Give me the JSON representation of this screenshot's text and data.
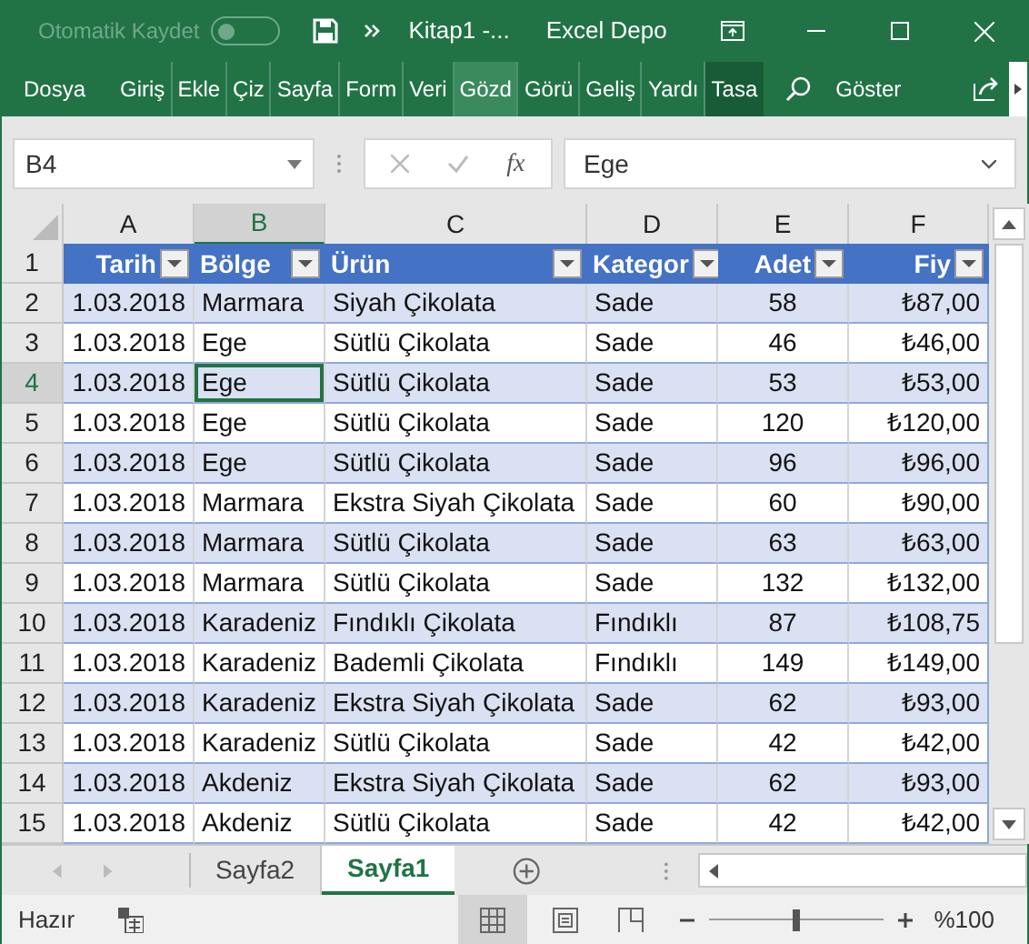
{
  "title_bar": {
    "autosave_label": "Otomatik Kaydet",
    "autosave_on": false,
    "document": "Kitap1  -...",
    "app": "Excel Depo"
  },
  "ribbon_tabs": [
    {
      "label": "Dosya",
      "kind": "file",
      "hovered": false
    },
    {
      "label": "Giriş",
      "kind": "standard",
      "hovered": false
    },
    {
      "label": "Ekle",
      "kind": "standard",
      "hovered": false
    },
    {
      "label": "Çiz",
      "kind": "standard",
      "hovered": false
    },
    {
      "label": "Sayfa",
      "kind": "standard",
      "hovered": false
    },
    {
      "label": "Form",
      "kind": "standard",
      "hovered": false
    },
    {
      "label": "Veri",
      "kind": "standard",
      "hovered": false
    },
    {
      "label": "Gözd",
      "kind": "standard",
      "hovered": true
    },
    {
      "label": "Görü",
      "kind": "standard",
      "hovered": false
    },
    {
      "label": "Geliş",
      "kind": "standard",
      "hovered": false
    },
    {
      "label": "Yardı",
      "kind": "standard",
      "hovered": false
    },
    {
      "label": "Tasa",
      "kind": "contextual",
      "hovered": false
    }
  ],
  "tell_me": "Göster",
  "name_box": "B4",
  "formula_bar": {
    "fx": "fx",
    "value": "Ege"
  },
  "columns": [
    {
      "label": "A",
      "selected": false
    },
    {
      "label": "B",
      "selected": true
    },
    {
      "label": "C",
      "selected": false
    },
    {
      "label": "D",
      "selected": false
    },
    {
      "label": "E",
      "selected": false
    },
    {
      "label": "F",
      "selected": false
    }
  ],
  "table_header": {
    "number": "1",
    "cells": [
      "Tarih",
      "Bölge",
      "Ürün",
      "Kategor",
      "Adet",
      "Fiy"
    ]
  },
  "rows": [
    {
      "number": "2",
      "selected": false,
      "cells": [
        "1.03.2018",
        "Marmara",
        "Siyah Çikolata",
        "Sade",
        "58",
        "₺87,00"
      ]
    },
    {
      "number": "3",
      "selected": false,
      "cells": [
        "1.03.2018",
        "Ege",
        "Sütlü Çikolata",
        "Sade",
        "46",
        "₺46,00"
      ]
    },
    {
      "number": "4",
      "selected": true,
      "cells": [
        "1.03.2018",
        "Ege",
        "Sütlü Çikolata",
        "Sade",
        "53",
        "₺53,00"
      ]
    },
    {
      "number": "5",
      "selected": false,
      "cells": [
        "1.03.2018",
        "Ege",
        "Sütlü Çikolata",
        "Sade",
        "120",
        "₺120,00"
      ]
    },
    {
      "number": "6",
      "selected": false,
      "cells": [
        "1.03.2018",
        "Ege",
        "Sütlü Çikolata",
        "Sade",
        "96",
        "₺96,00"
      ]
    },
    {
      "number": "7",
      "selected": false,
      "cells": [
        "1.03.2018",
        "Marmara",
        "Ekstra Siyah Çikolata",
        "Sade",
        "60",
        "₺90,00"
      ]
    },
    {
      "number": "8",
      "selected": false,
      "cells": [
        "1.03.2018",
        "Marmara",
        "Sütlü Çikolata",
        "Sade",
        "63",
        "₺63,00"
      ]
    },
    {
      "number": "9",
      "selected": false,
      "cells": [
        "1.03.2018",
        "Marmara",
        "Sütlü Çikolata",
        "Sade",
        "132",
        "₺132,00"
      ]
    },
    {
      "number": "10",
      "selected": false,
      "cells": [
        "1.03.2018",
        "Karadeniz",
        "Fındıklı Çikolata",
        "Fındıklı",
        "87",
        "₺108,75"
      ]
    },
    {
      "number": "11",
      "selected": false,
      "cells": [
        "1.03.2018",
        "Karadeniz",
        "Bademli Çikolata",
        "Fındıklı",
        "149",
        "₺149,00"
      ]
    },
    {
      "number": "12",
      "selected": false,
      "cells": [
        "1.03.2018",
        "Karadeniz",
        "Ekstra Siyah Çikolata",
        "Sade",
        "62",
        "₺93,00"
      ]
    },
    {
      "number": "13",
      "selected": false,
      "cells": [
        "1.03.2018",
        "Karadeniz",
        "Sütlü Çikolata",
        "Sade",
        "42",
        "₺42,00"
      ]
    },
    {
      "number": "14",
      "selected": false,
      "cells": [
        "1.03.2018",
        "Akdeniz",
        "Ekstra Siyah Çikolata",
        "Sade",
        "62",
        "₺93,00"
      ]
    },
    {
      "number": "15",
      "selected": false,
      "cells": [
        "1.03.2018",
        "Akdeniz",
        "Sütlü Çikolata",
        "Sade",
        "42",
        "₺42,00"
      ]
    }
  ],
  "sheet_tabs": [
    {
      "label": "Sayfa2",
      "selected": false
    },
    {
      "label": "Sayfa1",
      "selected": true
    }
  ],
  "status_bar": {
    "mode": "Hazır",
    "zoom": "%100",
    "level": 0.5
  }
}
